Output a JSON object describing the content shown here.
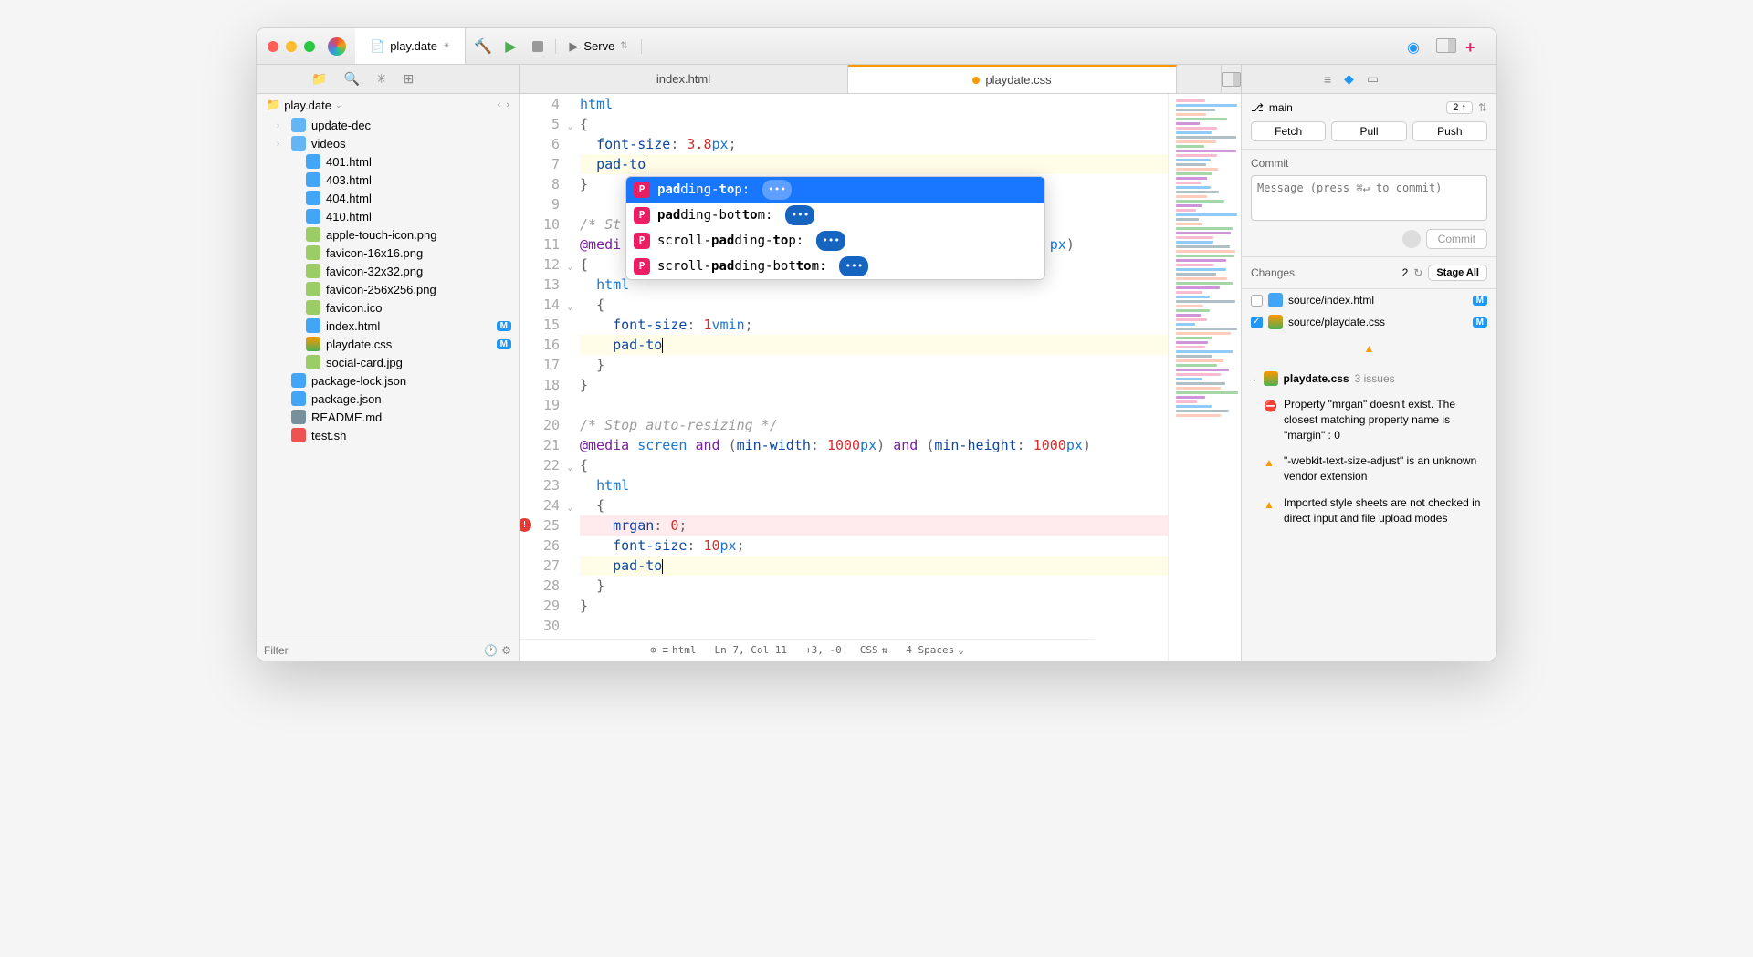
{
  "titlebar": {
    "project_tab": "play.date",
    "serve_label": "Serve"
  },
  "editor_tabs": {
    "tab1": "index.html",
    "tab2": "playdate.css"
  },
  "sidebar": {
    "root": "play.date",
    "filter_placeholder": "Filter",
    "items": [
      {
        "type": "folder",
        "name": "update-dec",
        "indent": 1,
        "disclosure": true
      },
      {
        "type": "folder",
        "name": "videos",
        "indent": 1,
        "disclosure": true
      },
      {
        "type": "html",
        "name": "401.html",
        "indent": 2
      },
      {
        "type": "html",
        "name": "403.html",
        "indent": 2
      },
      {
        "type": "html",
        "name": "404.html",
        "indent": 2
      },
      {
        "type": "html",
        "name": "410.html",
        "indent": 2
      },
      {
        "type": "img",
        "name": "apple-touch-icon.png",
        "indent": 2
      },
      {
        "type": "img",
        "name": "favicon-16x16.png",
        "indent": 2
      },
      {
        "type": "img",
        "name": "favicon-32x32.png",
        "indent": 2
      },
      {
        "type": "img",
        "name": "favicon-256x256.png",
        "indent": 2
      },
      {
        "type": "img",
        "name": "favicon.ico",
        "indent": 2
      },
      {
        "type": "html",
        "name": "index.html",
        "indent": 2,
        "badge": "M"
      },
      {
        "type": "css",
        "name": "playdate.css",
        "indent": 2,
        "badge": "M"
      },
      {
        "type": "img",
        "name": "social-card.jpg",
        "indent": 2
      },
      {
        "type": "json",
        "name": "package-lock.json",
        "indent": 1
      },
      {
        "type": "json",
        "name": "package.json",
        "indent": 1
      },
      {
        "type": "md",
        "name": "README.md",
        "indent": 1
      },
      {
        "type": "sh",
        "name": "test.sh",
        "indent": 1
      }
    ]
  },
  "code": {
    "lines": [
      {
        "n": 4,
        "html": "<span class='tok-sel'>html</span>"
      },
      {
        "n": 5,
        "html": "<span class='tok-punct'>{</span>"
      },
      {
        "n": 6,
        "html": "  <span class='tok-prop'>font-size</span><span class='tok-punct'>:</span> <span class='tok-num'>3.8</span><span class='tok-unit'>px</span><span class='tok-punct'>;</span>"
      },
      {
        "n": 7,
        "html": "  <span class='tok-prop'>pad-to</span><span class='cursor'></span>",
        "hl": "yellow",
        "marker": true
      },
      {
        "n": 8,
        "html": "<span class='tok-punct'>}</span>"
      },
      {
        "n": 9,
        "html": ""
      },
      {
        "n": 10,
        "html": "<span class='tok-comment'>/* St</span>"
      },
      {
        "n": 11,
        "html": "<span class='tok-at'>@medi</span>                                                    <span class='tok-unit'>px</span><span class='tok-punct'>)</span>"
      },
      {
        "n": 12,
        "html": "<span class='tok-punct'>{</span>"
      },
      {
        "n": 13,
        "html": "  <span class='tok-sel'>html</span>"
      },
      {
        "n": 14,
        "html": "  <span class='tok-punct'>{</span>"
      },
      {
        "n": 15,
        "html": "    <span class='tok-prop'>font-size</span><span class='tok-punct'>:</span> <span class='tok-num'>1</span><span class='tok-unit'>vmin</span><span class='tok-punct'>;</span>"
      },
      {
        "n": 16,
        "html": "    <span class='tok-prop'>pad-to</span><span class='cursor'></span>",
        "hl": "yellow",
        "marker": true
      },
      {
        "n": 17,
        "html": "  <span class='tok-punct'>}</span>"
      },
      {
        "n": 18,
        "html": "<span class='tok-punct'>}</span>"
      },
      {
        "n": 19,
        "html": ""
      },
      {
        "n": 20,
        "html": "<span class='tok-comment'>/* Stop auto-resizing */</span>"
      },
      {
        "n": 21,
        "html": "<span class='tok-at'>@media</span> <span class='tok-kw'>screen</span> <span class='tok-at'>and</span> <span class='tok-punct'>(</span><span class='tok-prop'>min-width</span><span class='tok-punct'>:</span> <span class='tok-num'>1000</span><span class='tok-unit'>px</span><span class='tok-punct'>)</span> <span class='tok-at'>and</span> <span class='tok-punct'>(</span><span class='tok-prop'>min-height</span><span class='tok-punct'>:</span> <span class='tok-num'>1000</span><span class='tok-unit'>px</span><span class='tok-punct'>)</span>"
      },
      {
        "n": 22,
        "html": "<span class='tok-punct'>{</span>"
      },
      {
        "n": 23,
        "html": "  <span class='tok-sel'>html</span>"
      },
      {
        "n": 24,
        "html": "  <span class='tok-punct'>{</span>"
      },
      {
        "n": 25,
        "html": "    <span class='tok-prop'>mrgan</span><span class='tok-punct'>:</span> <span class='tok-num'>0</span><span class='tok-punct'>;</span>",
        "hl": "red",
        "error": true
      },
      {
        "n": 26,
        "html": "    <span class='tok-prop'>font-size</span><span class='tok-punct'>:</span> <span class='tok-num'>10</span><span class='tok-unit'>px</span><span class='tok-punct'>;</span>"
      },
      {
        "n": 27,
        "html": "    <span class='tok-prop'>pad-to</span><span class='cursor'></span>",
        "hl": "yellow",
        "marker": true
      },
      {
        "n": 28,
        "html": "  <span class='tok-punct'>}</span>"
      },
      {
        "n": 29,
        "html": "<span class='tok-punct'>}</span>"
      },
      {
        "n": 30,
        "html": ""
      }
    ]
  },
  "autocomplete": {
    "items": [
      {
        "text": "<b>pad</b>ding-<b>to</b>p:",
        "selected": true
      },
      {
        "text": "<b>pad</b>ding-bot<b>to</b>m:"
      },
      {
        "text": "scroll-<b>pad</b>ding-<b>to</b>p:"
      },
      {
        "text": "scroll-<b>pad</b>ding-bot<b>to</b>m:"
      }
    ]
  },
  "statusbar": {
    "path": "html",
    "position": "Ln 7, Col 11",
    "diff": "+3, -0",
    "lang": "CSS",
    "indent": "4 Spaces"
  },
  "git": {
    "branch": "main",
    "ahead": "2 ↑",
    "fetch": "Fetch",
    "pull": "Pull",
    "push": "Push",
    "commit_label": "Commit",
    "commit_placeholder": "Message (press ⌘↵ to commit)",
    "commit_btn": "Commit",
    "changes_label": "Changes",
    "changes_count": "2",
    "stage_all": "Stage All",
    "files": [
      {
        "path": "source/index.html",
        "checked": false,
        "icon": "html",
        "badge": "M"
      },
      {
        "path": "source/playdate.css",
        "checked": true,
        "icon": "css",
        "badge": "M"
      }
    ]
  },
  "issues": {
    "file": "playdate.css",
    "count_label": "3 issues",
    "items": [
      {
        "type": "error",
        "text": "Property \"mrgan\" doesn't exist. The closest matching property name is \"margin\" : 0"
      },
      {
        "type": "warning",
        "text": "\"-webkit-text-size-adjust\" is an unknown vendor extension"
      },
      {
        "type": "warning",
        "text": "Imported style sheets are not checked in direct input and file upload modes"
      }
    ]
  }
}
